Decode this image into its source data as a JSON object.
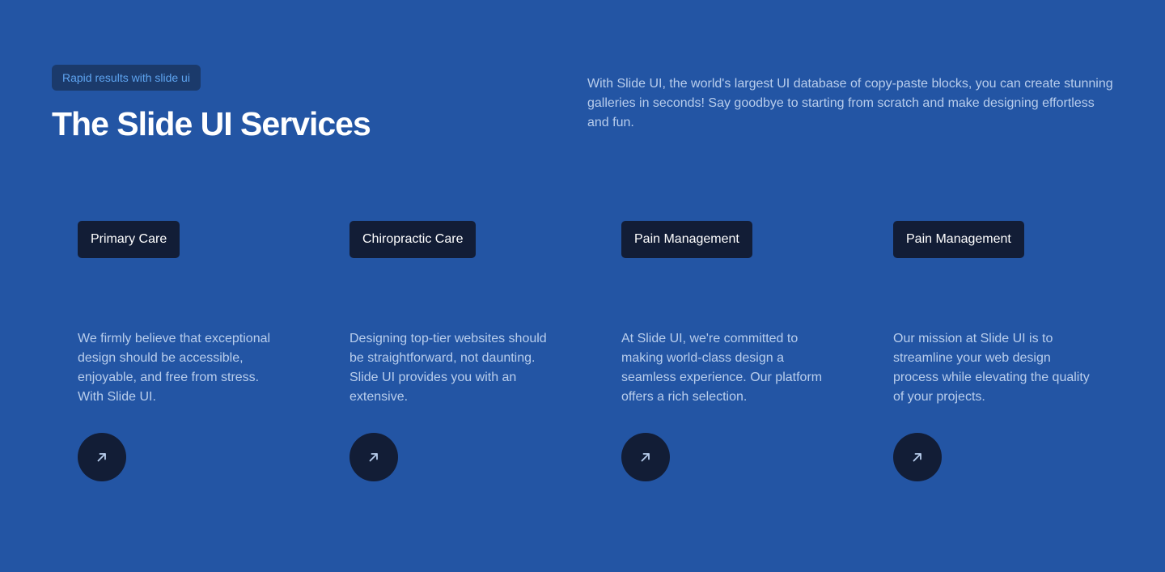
{
  "header": {
    "eyebrow": "Rapid results with slide ui",
    "title": "The Slide UI Services",
    "intro": "With Slide UI, the world's largest UI database of copy-paste blocks, you can create stunning galleries in seconds! Say goodbye to starting from scratch and make designing effortless and fun."
  },
  "services": [
    {
      "tag": "Primary Care",
      "text": "We firmly believe that exceptional design should be accessible, enjoyable, and free from stress. With Slide UI.",
      "icon": "arrow-up-right-icon"
    },
    {
      "tag": "Chiropractic Care",
      "text": "Designing top-tier websites should be straightforward, not daunting. Slide UI provides you with an extensive.",
      "icon": "arrow-up-right-icon"
    },
    {
      "tag": "Pain Management",
      "text": "At Slide UI, we're committed to making world-class design a seamless experience. Our platform offers a rich selection.",
      "icon": "arrow-up-right-icon"
    },
    {
      "tag": "Pain Management",
      "text": "Our mission at Slide UI is to streamline your web design process while elevating the quality of your projects.",
      "icon": "arrow-up-right-icon"
    }
  ],
  "colors": {
    "background": "#2355a4",
    "dark": "#121d36",
    "eyebrow_bg": "#1b3a6b",
    "eyebrow_text": "#5ea4f0",
    "body_text": "#b8cdec",
    "heading": "#ffffff"
  }
}
